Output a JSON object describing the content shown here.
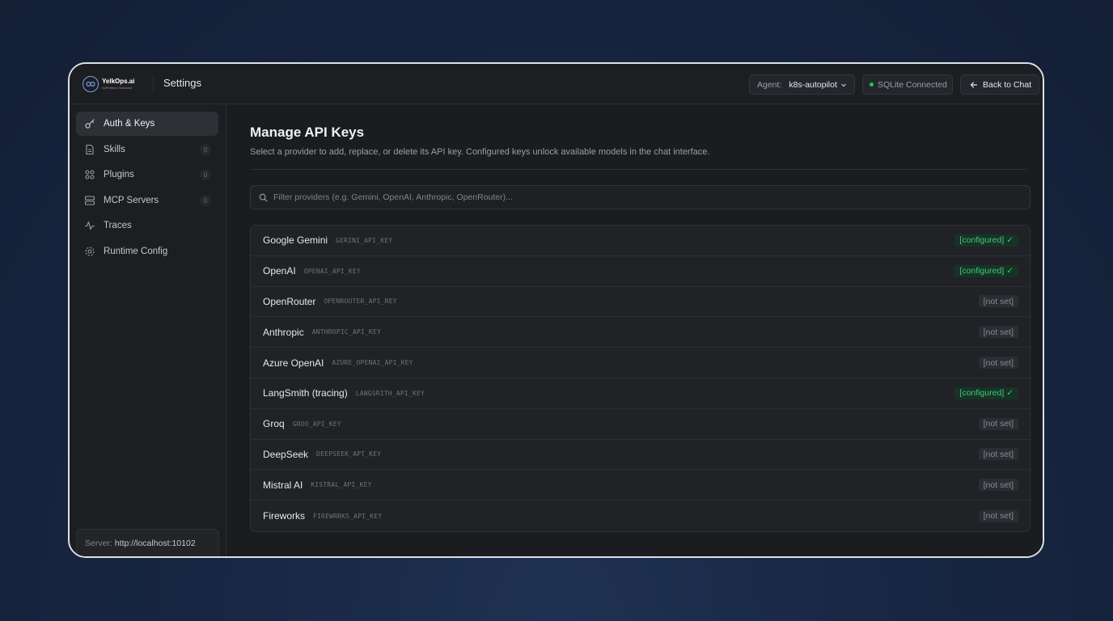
{
  "app": {
    "logo_name": "YelkOps.ai",
    "logo_tagline": "AI/Platform Standard"
  },
  "header": {
    "title": "Settings",
    "agent_label": "Agent:",
    "agent_value": "k8s-autopilot",
    "status": "SQLite Connected",
    "back_button": "Back to Chat"
  },
  "sidebar": {
    "items": [
      {
        "label": "Auth & Keys",
        "icon": "key-icon",
        "badge": null,
        "active": true
      },
      {
        "label": "Skills",
        "icon": "document-icon",
        "badge": "0"
      },
      {
        "label": "Plugins",
        "icon": "plugins-icon",
        "badge": "0"
      },
      {
        "label": "MCP Servers",
        "icon": "server-icon",
        "badge": "0"
      },
      {
        "label": "Traces",
        "icon": "activity-icon",
        "badge": null
      },
      {
        "label": "Runtime Config",
        "icon": "gear-icon",
        "badge": null
      }
    ],
    "server_label": "Server:",
    "server_value": "http://localhost:10102"
  },
  "main": {
    "title": "Manage API Keys",
    "description": "Select a provider to add, replace, or delete its API key. Configured keys unlock available models in the chat interface.",
    "search_placeholder": "Filter providers (e.g. Gemini, OpenAI, Anthropic, OpenRouter)...",
    "search_value": ""
  },
  "providers": [
    {
      "name": "Google Gemini",
      "env": "GERINI_API_KEY",
      "status": "[configured] ✓",
      "configured": true
    },
    {
      "name": "OpenAI",
      "env": "OPENAI_API_KEY",
      "status": "[configured] ✓",
      "configured": true
    },
    {
      "name": "OpenRouter",
      "env": "OPENROUTER_API_REY",
      "status": "[not set]",
      "configured": false
    },
    {
      "name": "Anthropic",
      "env": "ANTHROPIC_API_KEY",
      "status": "[not set]",
      "configured": false
    },
    {
      "name": "Azure OpenAI",
      "env": "AZURE_OPENAI_API_KEY",
      "status": "[not set]",
      "configured": false
    },
    {
      "name": "LangSmith (tracing)",
      "env": "LANGSRITH_API_KEY",
      "status": "[configured] ✓",
      "configured": true
    },
    {
      "name": "Groq",
      "env": "GROO_API_KEY",
      "status": "[not set]",
      "configured": false
    },
    {
      "name": "DeepSeek",
      "env": "DEEPSEEK_APT_KEY",
      "status": "[not set]",
      "configured": false
    },
    {
      "name": "Mistral AI",
      "env": "KISTRAL_API_KEY",
      "status": "[not set]",
      "configured": false
    },
    {
      "name": "Fireworks",
      "env": "FIREWRRKS_API_KEY",
      "status": "[not set]",
      "configured": false
    }
  ],
  "colors": {
    "accent": "#3fc77b",
    "status_dot": "#22c55e",
    "background": "#1b1c20"
  }
}
